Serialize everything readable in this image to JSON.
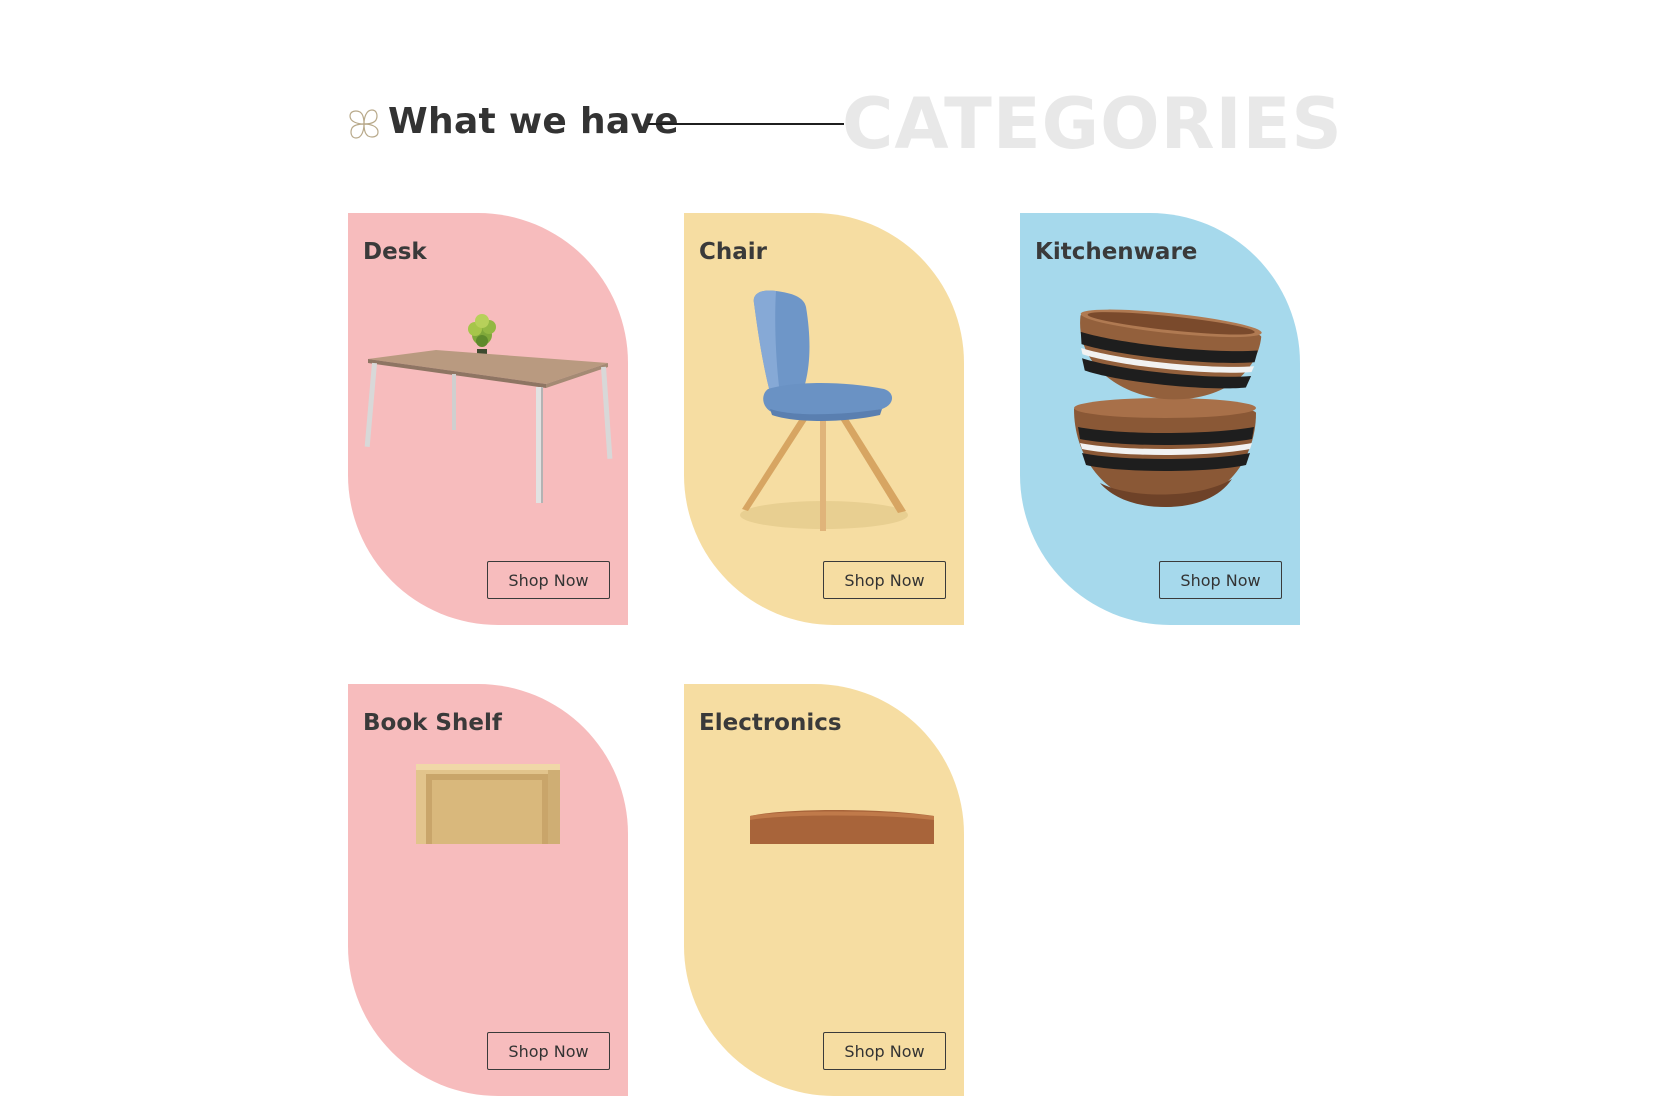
{
  "section": {
    "title": "What we have",
    "watermark": "CATEGORIES",
    "icon": "flower-icon"
  },
  "categories": [
    {
      "name": "Desk",
      "button_label": "Shop Now",
      "color": "#f7bcbd",
      "image": "desk-image"
    },
    {
      "name": "Chair",
      "button_label": "Shop Now",
      "color": "#f6dda2",
      "image": "chair-image"
    },
    {
      "name": "Kitchenware",
      "button_label": "Shop Now",
      "color": "#a6d9ec",
      "image": "bowls-image"
    },
    {
      "name": "Book Shelf",
      "button_label": "Shop Now",
      "color": "#f7bcbd",
      "image": "bookshelf-image"
    },
    {
      "name": "Electronics",
      "button_label": "Shop Now",
      "color": "#f6dda2",
      "image": "electronics-image"
    }
  ]
}
